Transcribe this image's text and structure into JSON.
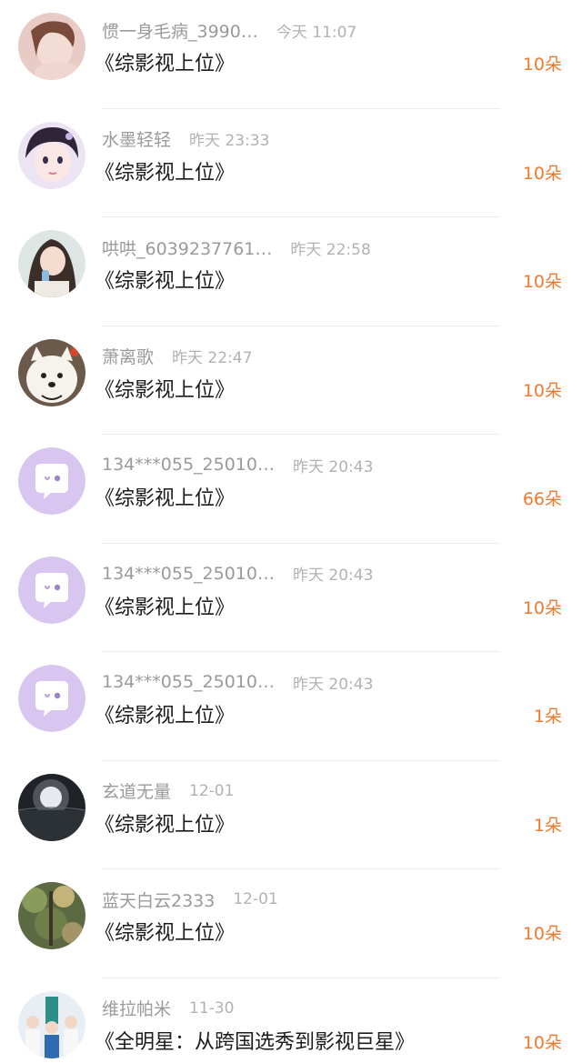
{
  "rows": [
    {
      "name": "惯一身毛病_3990…",
      "time": "今天 11:07",
      "title": "《综影视上位》",
      "gift": "10朵",
      "avatar": "girl-portrait"
    },
    {
      "name": "水墨轻轻",
      "time": "昨天 23:33",
      "title": "《综影视上位》",
      "gift": "10朵",
      "avatar": "anime-girl"
    },
    {
      "name": "哄哄_6039237761…",
      "time": "昨天 22:58",
      "title": "《综影视上位》",
      "gift": "10朵",
      "avatar": "girl-with-bottle"
    },
    {
      "name": "萧离歌",
      "time": "昨天 22:47",
      "title": "《综影视上位》",
      "gift": "10朵",
      "avatar": "white-dog"
    },
    {
      "name": "134***055_25010…",
      "time": "昨天 20:43",
      "title": "《综影视上位》",
      "gift": "66朵",
      "avatar": "default-chat-bubble"
    },
    {
      "name": "134***055_25010…",
      "time": "昨天 20:43",
      "title": "《综影视上位》",
      "gift": "10朵",
      "avatar": "default-chat-bubble"
    },
    {
      "name": "134***055_25010…",
      "time": "昨天 20:43",
      "title": "《综影视上位》",
      "gift": "1朵",
      "avatar": "default-chat-bubble"
    },
    {
      "name": "玄道无量",
      "time": "12-01",
      "title": "《综影视上位》",
      "gift": "1朵",
      "avatar": "moon-glow"
    },
    {
      "name": "蓝天白云2333",
      "time": "12-01",
      "title": "《综影视上位》",
      "gift": "10朵",
      "avatar": "forest-leaves"
    },
    {
      "name": "维拉帕米",
      "time": "11-30",
      "title": "《全明星：从跨国选秀到影视巨星》",
      "gift": "10朵",
      "avatar": "group-photo"
    }
  ],
  "colors": {
    "gift": "#f0792e",
    "default_avatar_bg": "#d8c6f1"
  }
}
